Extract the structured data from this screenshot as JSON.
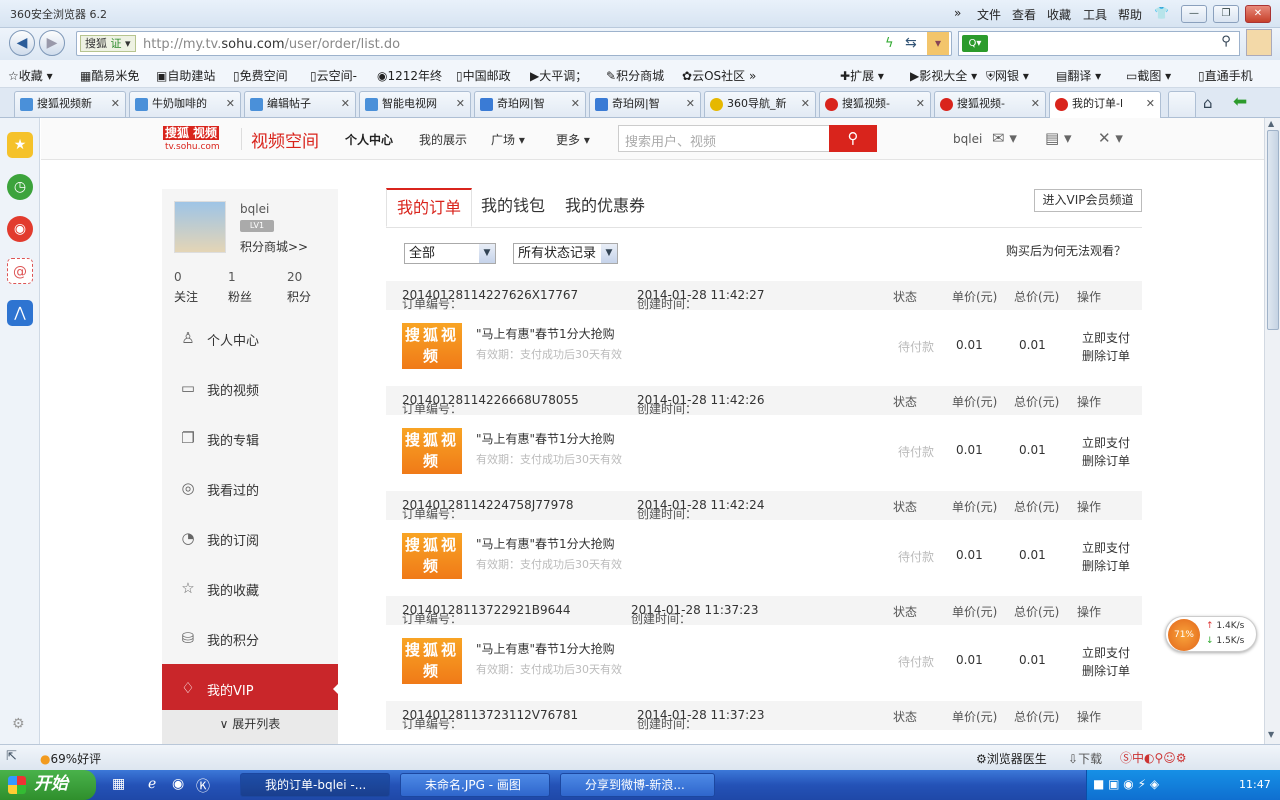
{
  "browser": {
    "title": "360安全浏览器 6.2",
    "menu": [
      "文件",
      "查看",
      "收藏",
      "工具",
      "帮助"
    ],
    "site_badge": "搜狐",
    "url_prefix": "http://my.tv.",
    "url_domain": "sohu.com",
    "url_path": "/user/order/list.do",
    "favorites": [
      "收藏",
      "酷易米免",
      "自助建站",
      "免费空间",
      "云空间-",
      "1212年终",
      "中国邮政",
      "大平调；",
      "积分商城",
      "云OS社区"
    ],
    "favorites_right": [
      "扩展",
      "影视大全",
      "网银",
      "翻译",
      "截图",
      "直通手机"
    ],
    "tabs": [
      "搜狐视频新",
      "牛奶咖啡的",
      "编辑帖子",
      "智能电视网",
      "奇珀网|智",
      "奇珀网|智",
      "360导航_新",
      "搜狐视频-",
      "搜狐视频-",
      "我的订单-l"
    ],
    "status_left": "69%好评",
    "status_doctor": "浏览器医生",
    "status_download": "下载",
    "speed": {
      "percent": "71%",
      "up": "1.4K/s",
      "down": "1.5K/s"
    }
  },
  "site": {
    "logo_line1": "搜狐",
    "logo_badge": "视频",
    "logo_line2": "tv.sohu.com",
    "space_title": "视频空间",
    "nav": [
      "个人中心",
      "我的展示",
      "广场",
      "更多"
    ],
    "search_placeholder": "搜索用户、视频",
    "username": "bqlei"
  },
  "profile": {
    "name": "bqlei",
    "level": "LV1",
    "mall_link": "积分商城>>",
    "stats": [
      {
        "n": "0",
        "label": "关注"
      },
      {
        "n": "1",
        "label": "粉丝"
      },
      {
        "n": "20",
        "label": "积分"
      }
    ]
  },
  "menu": [
    {
      "label": "个人中心",
      "icon": "person-icon"
    },
    {
      "label": "我的视频",
      "icon": "video-icon"
    },
    {
      "label": "我的专辑",
      "icon": "album-icon"
    },
    {
      "label": "我看过的",
      "icon": "eye-icon"
    },
    {
      "label": "我的订阅",
      "icon": "rss-icon"
    },
    {
      "label": "我的收藏",
      "icon": "star-icon"
    },
    {
      "label": "我的积分",
      "icon": "coins-icon"
    },
    {
      "label": "我的VIP",
      "icon": "diamond-icon"
    }
  ],
  "expand_label": "展开列表",
  "main": {
    "tabs": [
      "我的订单",
      "我的钱包",
      "我的优惠券"
    ],
    "vip_button": "进入VIP会员频道",
    "filter_type": "全部",
    "filter_status": "所有状态记录",
    "why_link": "购买后为何无法观看？",
    "col_status": "状态",
    "col_price": "单价(元)",
    "col_total": "总价(元)",
    "col_action": "操作",
    "order_no_label": "订单编号：",
    "created_label": "创建时间：",
    "orders": [
      {
        "no": "20140128114227626X17767",
        "time": "2014-01-28 11:42:27",
        "thumb": "搜狐视频",
        "title": "\"马上有惠\"春节1分大抢购",
        "validity": "有效期：支付成功后30天有效",
        "status": "待付款",
        "price": "0.01",
        "total": "0.01",
        "pay": "立即支付",
        "delete": "删除订单"
      },
      {
        "no": "20140128114226668U78055",
        "time": "2014-01-28 11:42:26",
        "thumb": "搜狐视频",
        "title": "\"马上有惠\"春节1分大抢购",
        "validity": "有效期：支付成功后30天有效",
        "status": "待付款",
        "price": "0.01",
        "total": "0.01",
        "pay": "立即支付",
        "delete": "删除订单"
      },
      {
        "no": "20140128114224758J77978",
        "time": "2014-01-28 11:42:24",
        "thumb": "搜狐视频",
        "title": "\"马上有惠\"春节1分大抢购",
        "validity": "有效期：支付成功后30天有效",
        "status": "待付款",
        "price": "0.01",
        "total": "0.01",
        "pay": "立即支付",
        "delete": "删除订单"
      },
      {
        "no": "20140128113722921B9644",
        "time": "2014-01-28 11:37:23",
        "thumb": "搜狐视频",
        "title": "\"马上有惠\"春节1分大抢购",
        "validity": "有效期：支付成功后30天有效",
        "status": "待付款",
        "price": "0.01",
        "total": "0.01",
        "pay": "立即支付",
        "delete": "删除订单"
      }
    ],
    "last_order_no": "20140128113723112V76781",
    "last_order_time": "2014-01-28 11:37:23"
  },
  "taskbar": {
    "start": "开始",
    "tasks": [
      "我的订单-bqlei -...",
      "未命名.JPG - 画图",
      "分享到微博-新浪..."
    ],
    "clock": "11:47"
  },
  "colors": {
    "accent": "#d9241c",
    "vip_active": "#c9262a",
    "thumb": "#f28a1e"
  }
}
